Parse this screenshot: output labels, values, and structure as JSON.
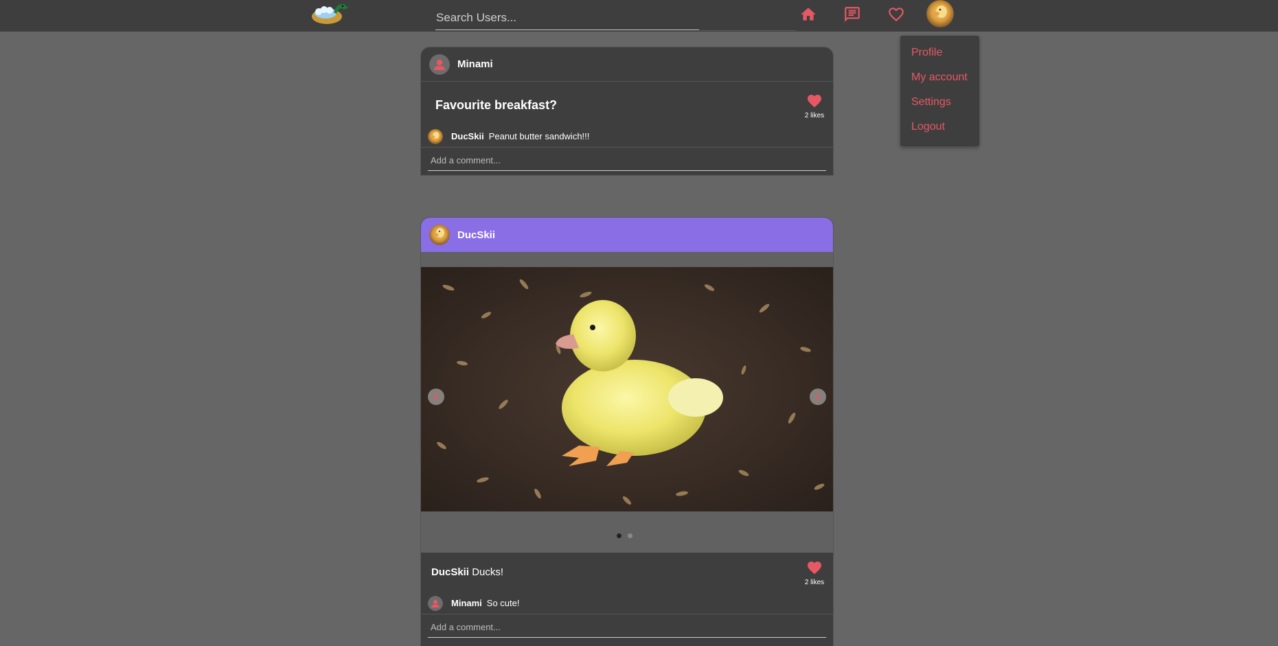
{
  "header": {
    "search_placeholder": "Search Users...",
    "nav_icons": [
      "home-icon",
      "chat-icon",
      "heart-icon"
    ],
    "accent_color": "#e65864"
  },
  "dropdown": {
    "items": [
      "Profile",
      "My account",
      "Settings",
      "Logout"
    ]
  },
  "posts": [
    {
      "author": "Minami",
      "title": "Favourite breakfast?",
      "likes_label": "2 likes",
      "comments": [
        {
          "user": "DucSkii",
          "text": "Peanut butter sandwich!!!"
        }
      ],
      "add_comment_placeholder": "Add a comment..."
    },
    {
      "author": "DucSkii",
      "header_color": "#8a6ee6",
      "carousel_slides": 2,
      "carousel_active": 1,
      "caption_user": "DucSkii",
      "caption_text": " Ducks!",
      "likes_label": "2 likes",
      "comments": [
        {
          "user": "Minami",
          "text": "So cute!"
        }
      ],
      "add_comment_placeholder": "Add a comment..."
    }
  ]
}
